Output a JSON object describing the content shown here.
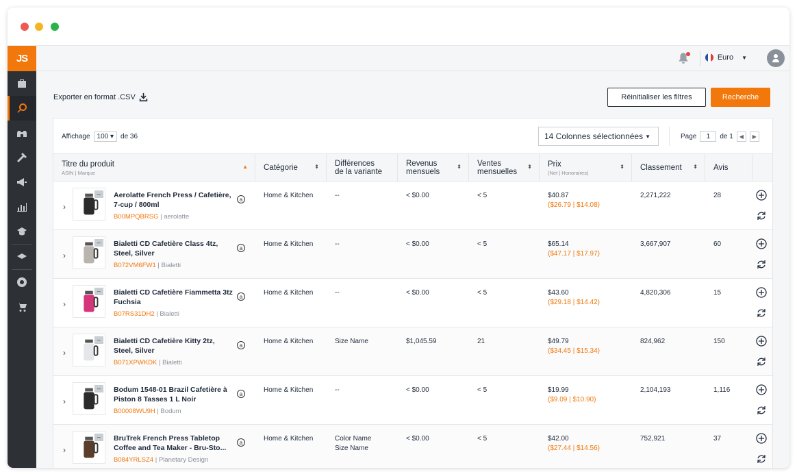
{
  "header": {
    "logo": "JS",
    "currency": "Euro"
  },
  "toolbar": {
    "export_label": "Exporter en format .CSV",
    "reset_label": "Réinitialiser les filtres",
    "search_label": "Recherche"
  },
  "table_controls": {
    "show_label": "Affichage",
    "page_size": "100",
    "of_label": "de 36",
    "columns_selected": "14 Colonnes sélectionnées",
    "page_label": "Page",
    "page_number": "1",
    "page_of": "de 1"
  },
  "columns": {
    "title": "Titre du produit",
    "title_sub": "ASIN | Marque",
    "category": "Catégorie",
    "diff_1": "Différences",
    "diff_2": "de la variante",
    "revenue_1": "Revenus",
    "revenue_2": "mensuels",
    "sales_1": "Ventes",
    "sales_2": "mensuelles",
    "price": "Prix",
    "price_sub": "(Net | Honoraires)",
    "rank": "Classement",
    "reviews": "Avis"
  },
  "rows": [
    {
      "title": "Aerolatte French Press / Cafetière, 7-cup / 800ml",
      "asin": "B00MPQBRSG",
      "brand": "aerolatte",
      "category": "Home & Kitchen",
      "variant": "--",
      "variant2": "",
      "revenue": "< $0.00",
      "sales": "< 5",
      "price": "$40.87",
      "net": "($26.79",
      "fees": "$14.08)",
      "rank": "2,271,222",
      "reviews": "28",
      "thumb_tag": "--"
    },
    {
      "title": "Bialetti CD Cafetière Class 4tz, Steel, Silver",
      "asin": "B072VM6FW1",
      "brand": "Bialetti",
      "category": "Home & Kitchen",
      "variant": "--",
      "variant2": "",
      "revenue": "< $0.00",
      "sales": "< 5",
      "price": "$65.14",
      "net": "($47.17",
      "fees": "$17.97)",
      "rank": "3,667,907",
      "reviews": "60",
      "thumb_tag": "--"
    },
    {
      "title": "Bialetti CD Cafetière Fiammetta 3tz Fuchsia",
      "asin": "B07RS31DH2",
      "brand": "Bialetti",
      "category": "Home & Kitchen",
      "variant": "--",
      "variant2": "",
      "revenue": "< $0.00",
      "sales": "< 5",
      "price": "$43.60",
      "net": "($29.18",
      "fees": "$14.42)",
      "rank": "4,820,306",
      "reviews": "15",
      "thumb_tag": "--"
    },
    {
      "title": "Bialetti CD Cafetière Kitty 2tz, Steel, Silver",
      "asin": "B071XPWKDK",
      "brand": "Bialetti",
      "category": "Home & Kitchen",
      "variant": "Size Name",
      "variant2": "",
      "revenue": "$1,045.59",
      "sales": "21",
      "price": "$49.79",
      "net": "($34.45",
      "fees": "$15.34)",
      "rank": "824,962",
      "reviews": "150",
      "thumb_tag": "--"
    },
    {
      "title": "Bodum 1548-01 Brazil Cafetière à Piston 8 Tasses 1 L Noir",
      "asin": "B00008WU9H",
      "brand": "Bodum",
      "category": "Home & Kitchen",
      "variant": "--",
      "variant2": "",
      "revenue": "< $0.00",
      "sales": "< 5",
      "price": "$19.99",
      "net": "($9.09",
      "fees": "$10.90)",
      "rank": "2,104,193",
      "reviews": "1,116",
      "thumb_tag": "--"
    },
    {
      "title": "BruTrek French Press Tabletop Coffee and Tea Maker - Bru-Sto...",
      "asin": "B084YRLSZ4",
      "brand": "Planetary Design",
      "category": "Home & Kitchen",
      "variant": "Color Name",
      "variant2": "Size Name",
      "revenue": "< $0.00",
      "sales": "< 5",
      "price": "$42.00",
      "net": "($27.44",
      "fees": "$14.56)",
      "rank": "752,921",
      "reviews": "37",
      "thumb_tag": "--"
    }
  ],
  "colors": {
    "accent": "#f2780c",
    "sidebar": "#2d3035"
  },
  "icons": [
    "suitcase-icon",
    "search-icon",
    "binoculars-icon",
    "hammer-icon",
    "megaphone-icon",
    "bar-chart-icon",
    "graduation-cap-icon",
    "academy-icon",
    "chrome-icon",
    "cart-icon",
    "bell-icon",
    "user-icon",
    "download-icon",
    "amazon-icon",
    "add-icon",
    "refresh-icon"
  ]
}
